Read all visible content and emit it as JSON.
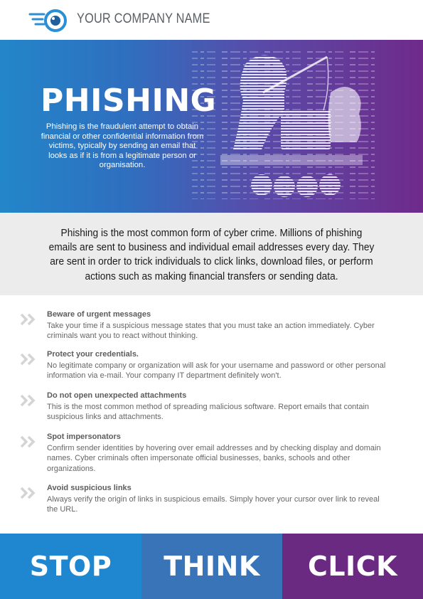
{
  "header": {
    "company_name": "YOUR COMPANY NAME",
    "logo_icon": "eye-logo-icon"
  },
  "hero": {
    "title": "PHISHING",
    "description": "Phishing is the fraudulent attempt to obtain  financial or other confidential information from victims, typically by sending an email that looks as if it is from a legitimate person or organisation.",
    "illustration": "hacker-in-hoodie-with-fishing-rod-illustration"
  },
  "intro": {
    "text": "Phishing is the most common form of cyber crime. Millions of phishing emails are sent to business and individual email addresses every day. They are sent in order to trick individuals to click links, download files,  or perform actions such as making financial transfers or sending data."
  },
  "tips": [
    {
      "title": "Beware of urgent messages",
      "body": "Take your time if a suspicious message states that you must take an action immediately. Cyber criminals want you to react without thinking."
    },
    {
      "title": "Protect your credentials.",
      "body": "No legitimate company or organization will ask for your username and password or other personal information via e-mail. Your company IT department definitely won't."
    },
    {
      "title": "Do not open unexpected attachments",
      "body": "This is the most common method of spreading malicious software. Report emails that contain suspicious links and attachments."
    },
    {
      "title": "Spot impersonators",
      "body": "Confirm sender identities by hovering over email addresses and by checking display and domain names. Cyber criminals often impersonate official businesses, banks, schools and other organizations."
    },
    {
      "title": "Avoid suspicious links",
      "body": "Always verify the origin of links in suspicious emails. Simply hover your cursor over link to reveal the URL."
    }
  ],
  "footer": [
    {
      "label": "STOP",
      "color": "#1f86d0"
    },
    {
      "label": "THINK",
      "color": "#3a74b8"
    },
    {
      "label": "CLICK",
      "color": "#6b2a82"
    }
  ],
  "colors": {
    "accent_blue": "#2386c9",
    "accent_purple": "#6f2a8a",
    "chevron": "#d4d4d4",
    "logo_blue": "#2b8fd6"
  }
}
